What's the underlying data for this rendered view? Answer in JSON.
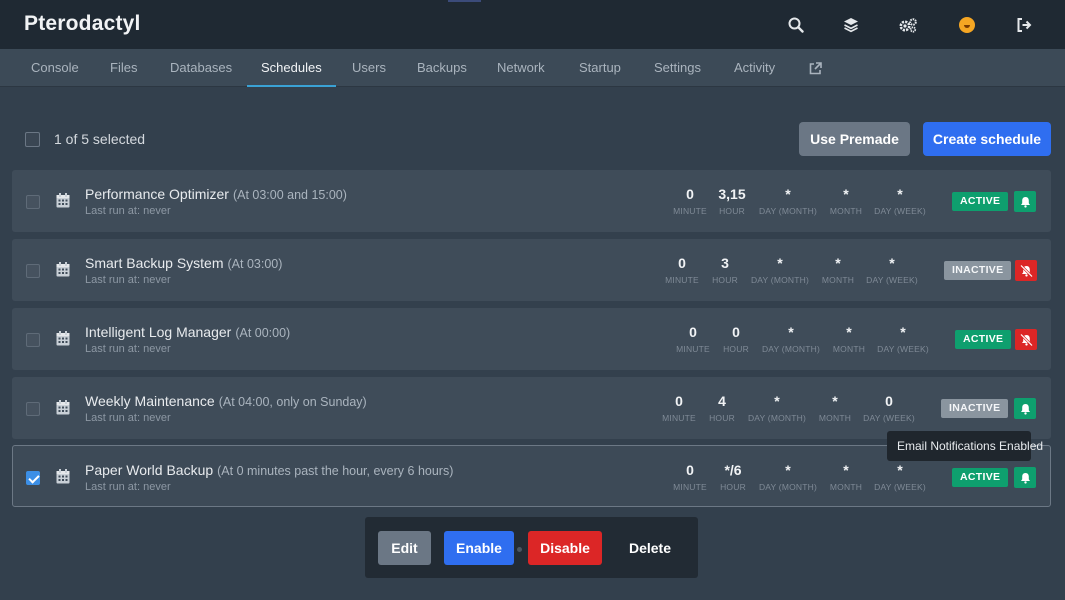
{
  "app": {
    "title": "Pterodactyl"
  },
  "topbar": {
    "icons": [
      "search-icon",
      "layers-icon",
      "cogs-icon",
      "avatar",
      "sign-out-icon"
    ]
  },
  "tabs": [
    {
      "label": "Console"
    },
    {
      "label": "Files"
    },
    {
      "label": "Databases"
    },
    {
      "label": "Schedules",
      "active": true
    },
    {
      "label": "Users"
    },
    {
      "label": "Backups"
    },
    {
      "label": "Network"
    },
    {
      "label": "Startup"
    },
    {
      "label": "Settings"
    },
    {
      "label": "Activity"
    },
    {
      "label": "",
      "icon": "external-link-icon"
    }
  ],
  "toolbar": {
    "selected_text": "1 of 5 selected",
    "use_premade_label": "Use Premade",
    "create_label": "Create schedule"
  },
  "cron_labels": {
    "minute": "MINUTE",
    "hour": "HOUR",
    "dom": "DAY (MONTH)",
    "month": "MONTH",
    "dow": "DAY (WEEK)"
  },
  "schedules": [
    {
      "name": "Performance Optimizer",
      "desc": "(At 03:00 and 15:00)",
      "last_run": "Last run at: never",
      "minute": "0",
      "hour": "3,15",
      "dom": "*",
      "month": "*",
      "dow": "*",
      "status": "ACTIVE",
      "notifications": true,
      "selected": false
    },
    {
      "name": "Smart Backup System",
      "desc": "(At 03:00)",
      "last_run": "Last run at: never",
      "minute": "0",
      "hour": "3",
      "dom": "*",
      "month": "*",
      "dow": "*",
      "status": "INACTIVE",
      "notifications": false,
      "selected": false
    },
    {
      "name": "Intelligent Log Manager",
      "desc": "(At 00:00)",
      "last_run": "Last run at: never",
      "minute": "0",
      "hour": "0",
      "dom": "*",
      "month": "*",
      "dow": "*",
      "status": "ACTIVE",
      "notifications": false,
      "selected": false
    },
    {
      "name": "Weekly Maintenance",
      "desc": "(At 04:00, only on Sunday)",
      "last_run": "Last run at: never",
      "minute": "0",
      "hour": "4",
      "dom": "*",
      "month": "*",
      "dow": "0",
      "status": "INACTIVE",
      "notifications": true,
      "selected": false
    },
    {
      "name": "Paper World Backup",
      "desc": "(At 0 minutes past the hour, every 6 hours)",
      "last_run": "Last run at: never",
      "minute": "0",
      "hour": "*/6",
      "dom": "*",
      "month": "*",
      "dow": "*",
      "status": "ACTIVE",
      "notifications": true,
      "selected": true
    }
  ],
  "tooltip": {
    "text": "Email Notifications Enabled"
  },
  "bulk_actions": {
    "edit_label": "Edit",
    "enable_label": "Enable",
    "disable_label": "Disable",
    "delete_label": "Delete"
  },
  "colors": {
    "active": "#0e9f6e",
    "inactive": "#8a959f",
    "danger": "#dc2626",
    "primary": "#2f6ef0",
    "tab_accent": "#3aa2d5"
  }
}
